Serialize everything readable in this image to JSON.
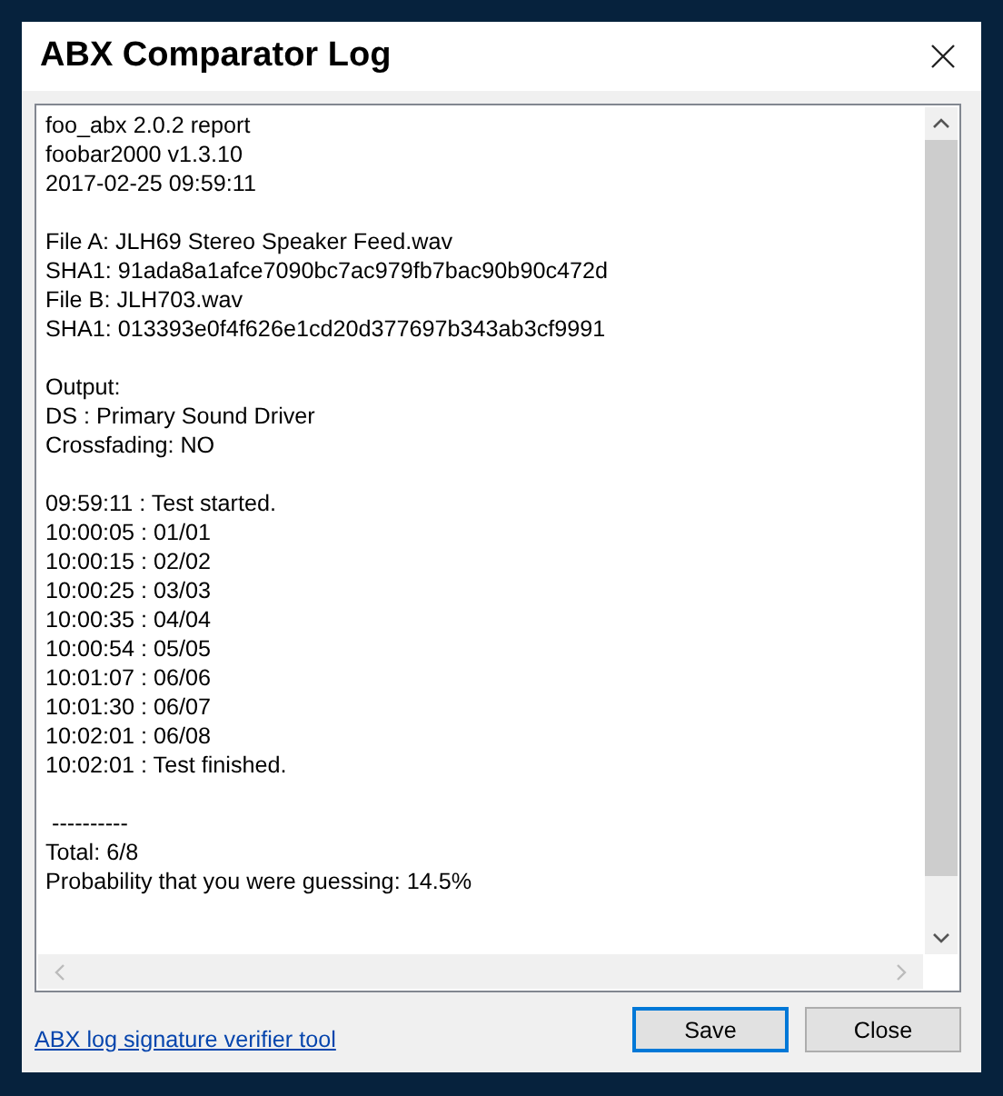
{
  "window": {
    "title": "ABX Comparator Log"
  },
  "log": {
    "blocks": [
      [
        "foo_abx 2.0.2 report",
        "foobar2000 v1.3.10",
        "2017-02-25 09:59:11"
      ],
      [
        "File A: JLH69 Stereo Speaker Feed.wav",
        "SHA1: 91ada8a1afce7090bc7ac979fb7bac90b90c472d",
        "File B: JLH703.wav",
        "SHA1: 013393e0f4f626e1cd20d377697b343ab3cf9991"
      ],
      [
        "Output:",
        "DS : Primary Sound Driver",
        "Crossfading: NO"
      ],
      [
        "09:59:11 : Test started.",
        "10:00:05 : 01/01",
        "10:00:15 : 02/02",
        "10:00:25 : 03/03",
        "10:00:35 : 04/04",
        "10:00:54 : 05/05",
        "10:01:07 : 06/06",
        "10:01:30 : 06/07",
        "10:02:01 : 06/08",
        "10:02:01 : Test finished."
      ],
      [
        " ----------",
        "Total: 6/8",
        "Probability that you were guessing: 14.5%"
      ]
    ]
  },
  "link": "ABX log signature verifier tool",
  "buttons": [
    {
      "label": "Save",
      "default": true
    },
    {
      "label": "Close",
      "default": false
    }
  ]
}
